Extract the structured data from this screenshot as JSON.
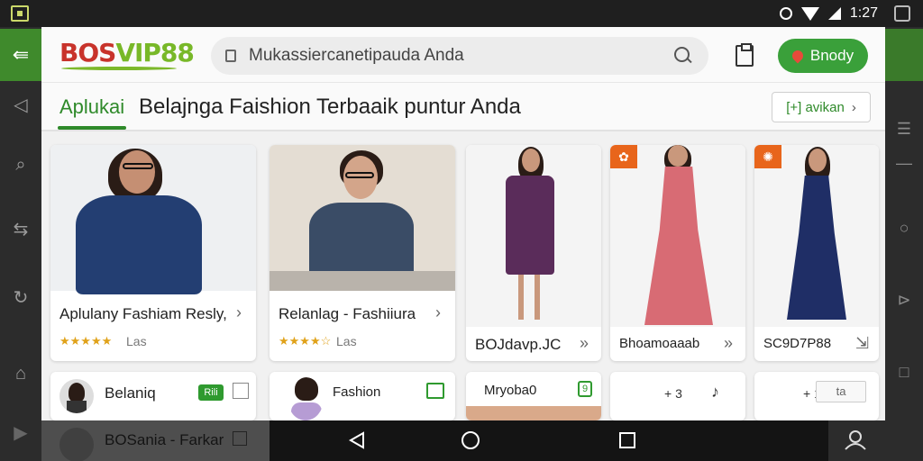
{
  "status_bar": {
    "time": "1:27"
  },
  "header": {
    "logo_part1": "BOS",
    "logo_part2": "VIP88",
    "search_value": "Mukassiercanetipauda Anda",
    "ready_label": "Bnody"
  },
  "subheader": {
    "tab_label": "Aplukai",
    "headline": "Belajnga Faishion Terbaaik puntur Anda",
    "pill_label": "[+] avikan"
  },
  "products": [
    {
      "caption": "Aplulany Fashiam Resly,",
      "stars": "★★★★★",
      "label": "Las"
    },
    {
      "caption": "Relanlag - Fashiiura",
      "stars": "★★★★☆",
      "label": "Las"
    },
    {
      "caption": "BOJdavp.JC",
      "label": "»"
    },
    {
      "caption": "Bhoamoaaab",
      "label": "»"
    },
    {
      "caption": "SC9D7P88",
      "label": ""
    }
  ],
  "row2": [
    {
      "title": "Belaniq",
      "tag": "Rili"
    },
    {
      "title": "Fashion"
    },
    {
      "title": "Mryoba0",
      "tag": "9"
    },
    {
      "meta": "+ 3"
    },
    {
      "meta": "+ 1",
      "extra": "ta"
    }
  ],
  "bottom_preview": {
    "title": "BOSania - Farkar"
  },
  "colors": {
    "brand_green": "#2f8a2a",
    "brand_red": "#c8332b",
    "accent_orange": "#e8651b"
  }
}
